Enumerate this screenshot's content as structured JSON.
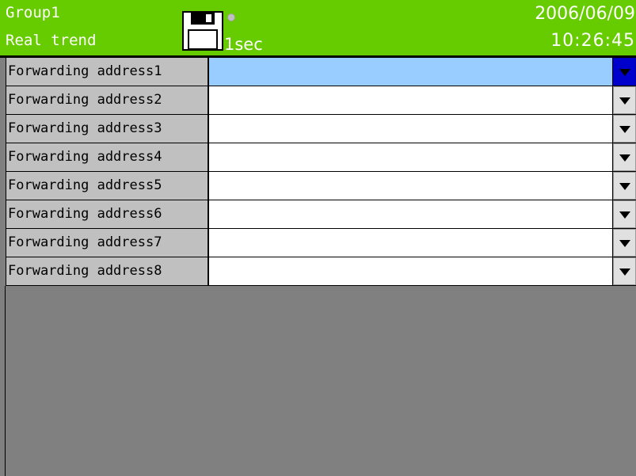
{
  "header": {
    "group": "Group1",
    "view": "Real trend",
    "interval": "1sec",
    "date": "2006/06/09",
    "time": "10:26:45",
    "icons": {
      "storage": "floppy-disk-icon",
      "status": "status-dot-icon"
    }
  },
  "rows": [
    {
      "label": "Forwarding address1",
      "value": "",
      "selected": true
    },
    {
      "label": "Forwarding address2",
      "value": ""
    },
    {
      "label": "Forwarding address3",
      "value": ""
    },
    {
      "label": "Forwarding address4",
      "value": ""
    },
    {
      "label": "Forwarding address5",
      "value": ""
    },
    {
      "label": "Forwarding address6",
      "value": ""
    },
    {
      "label": "Forwarding address7",
      "value": ""
    },
    {
      "label": "Forwarding address8",
      "value": ""
    }
  ],
  "colors": {
    "header_bg": "#66cc00",
    "selected_field": "#99ccff",
    "selected_dropdown": "#0000cc",
    "background": "#808080"
  }
}
